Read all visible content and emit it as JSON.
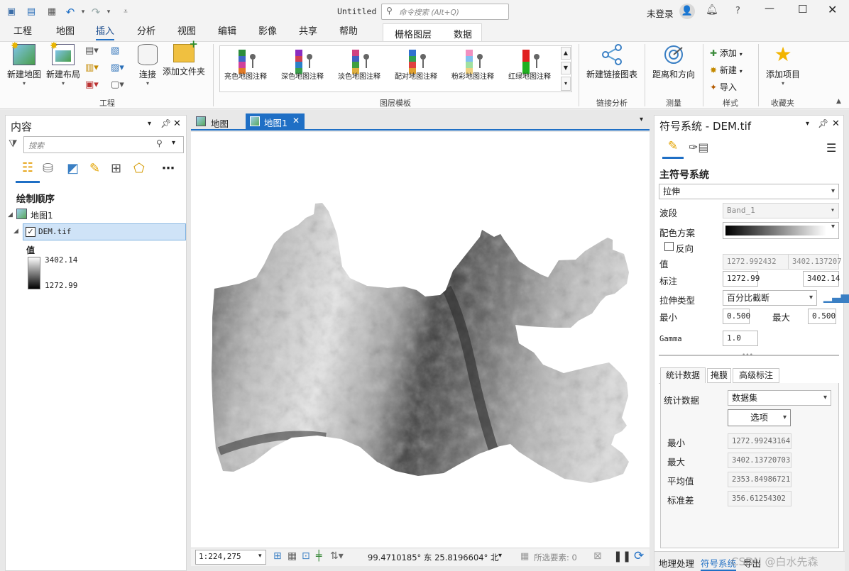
{
  "title_bar": {
    "doc_title": "Untitled",
    "command_search_placeholder": "命令搜索 (Alt+Q)",
    "user_status": "未登录",
    "help": "?"
  },
  "ribbon": {
    "tabs": [
      "工程",
      "地图",
      "插入",
      "分析",
      "视图",
      "编辑",
      "影像",
      "共享",
      "帮助"
    ],
    "contextual_tabs": [
      "栅格图层",
      "数据"
    ],
    "active_tab": "插入",
    "project_group": {
      "label": "工程",
      "new_map": "新建地图",
      "new_layout": "新建布局",
      "connect": "连接",
      "add_folder": "添加文件夹"
    },
    "layer_templates": {
      "label": "图层模板",
      "items": [
        "亮色地图注释",
        "深色地图注释",
        "淡色地图注释",
        "配对地图注释",
        "粉彩地图注释",
        "红绿地图注释"
      ]
    },
    "link_analysis": {
      "label": "链接分析",
      "btn": "新建链接图表"
    },
    "measure": {
      "label": "测量",
      "btn": "距离和方向"
    },
    "styles": {
      "label": "样式",
      "add": "添加",
      "new": "新建",
      "import": "导入"
    },
    "favorites": {
      "label": "收藏夹",
      "btn": "添加项目"
    }
  },
  "contents": {
    "title": "内容",
    "search_placeholder": "搜索",
    "drawing_order": "绘制顺序",
    "map_name": "地图1",
    "layer_name": "DEM.tif",
    "legend_title": "值",
    "legend_max": "3402.14",
    "legend_min": "1272.99"
  },
  "map_view": {
    "tabs": [
      "地图",
      "地图1"
    ],
    "active_tab": "地图1",
    "scale": "1:224,275",
    "coords": "99.4710185° 东  25.8196604° 北",
    "selected_features": "所选要素: 0"
  },
  "symbology": {
    "title": "符号系统 - DEM.tif",
    "primary": "主符号系统",
    "renderer": "拉伸",
    "band_label": "波段",
    "band_value": "Band_1",
    "color_scheme_label": "配色方案",
    "invert_label": "反向",
    "value_label": "值",
    "value_min": "1272.992432",
    "value_max": "3402.137207",
    "annotation_label": "标注",
    "annotation_min": "1272.99",
    "annotation_max": "3402.14",
    "stretch_type_label": "拉伸类型",
    "stretch_type": "百分比截断",
    "min_label": "最小",
    "min_value": "0.500",
    "max_label": "最大",
    "max_value": "0.500",
    "gamma_label": "Gamma",
    "gamma_value": "1.0",
    "sub_tabs": [
      "统计数据",
      "掩膜",
      "高级标注"
    ],
    "stats_label": "统计数据",
    "stats_source": "数据集",
    "options_btn": "选项",
    "stat_rows": [
      {
        "label": "最小",
        "value": "1272.99243164"
      },
      {
        "label": "最大",
        "value": "3402.13720703"
      },
      {
        "label": "平均值",
        "value": "2353.84986721"
      },
      {
        "label": "标准差",
        "value": "356.61254302"
      }
    ],
    "bottom_tabs": [
      "地理处理",
      "符号系统",
      "导出"
    ],
    "watermark": "CSDN @白水先森"
  }
}
